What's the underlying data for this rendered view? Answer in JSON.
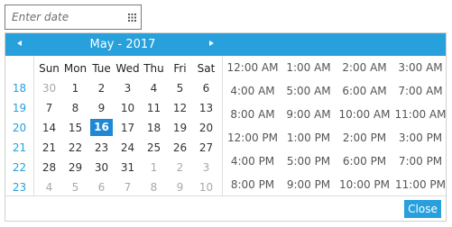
{
  "input": {
    "placeholder": "Enter date",
    "icon": "calendar-grid-icon"
  },
  "header": {
    "month_title": "May - 2017",
    "prev_icon": "triangle-left-icon",
    "next_icon": "triangle-right-icon",
    "background": "#27a0dc"
  },
  "calendar": {
    "weekdays": [
      "Sun",
      "Mon",
      "Tue",
      "Wed",
      "Thu",
      "Fri",
      "Sat"
    ],
    "week_numbers": [
      "18",
      "19",
      "20",
      "21",
      "22",
      "23"
    ],
    "weeks": [
      [
        "30",
        "1",
        "2",
        "3",
        "4",
        "5",
        "6"
      ],
      [
        "7",
        "8",
        "9",
        "10",
        "11",
        "12",
        "13"
      ],
      [
        "14",
        "15",
        "16",
        "17",
        "18",
        "19",
        "20"
      ],
      [
        "21",
        "22",
        "23",
        "24",
        "25",
        "26",
        "27"
      ],
      [
        "28",
        "29",
        "30",
        "31",
        "1",
        "2",
        "3"
      ],
      [
        "4",
        "5",
        "6",
        "7",
        "8",
        "9",
        "10"
      ]
    ],
    "selected_day": "16",
    "accent": "#1e88d4"
  },
  "times": [
    [
      "12:00 AM",
      "1:00 AM",
      "2:00 AM",
      "3:00 AM"
    ],
    [
      "4:00 AM",
      "5:00 AM",
      "6:00 AM",
      "7:00 AM"
    ],
    [
      "8:00 AM",
      "9:00 AM",
      "10:00 AM",
      "11:00 AM"
    ],
    [
      "12:00 PM",
      "1:00 PM",
      "2:00 PM",
      "3:00 PM"
    ],
    [
      "4:00 PM",
      "5:00 PM",
      "6:00 PM",
      "7:00 PM"
    ],
    [
      "8:00 PM",
      "9:00 PM",
      "10:00 PM",
      "11:00 PM"
    ]
  ],
  "footer": {
    "close_label": "Close"
  }
}
